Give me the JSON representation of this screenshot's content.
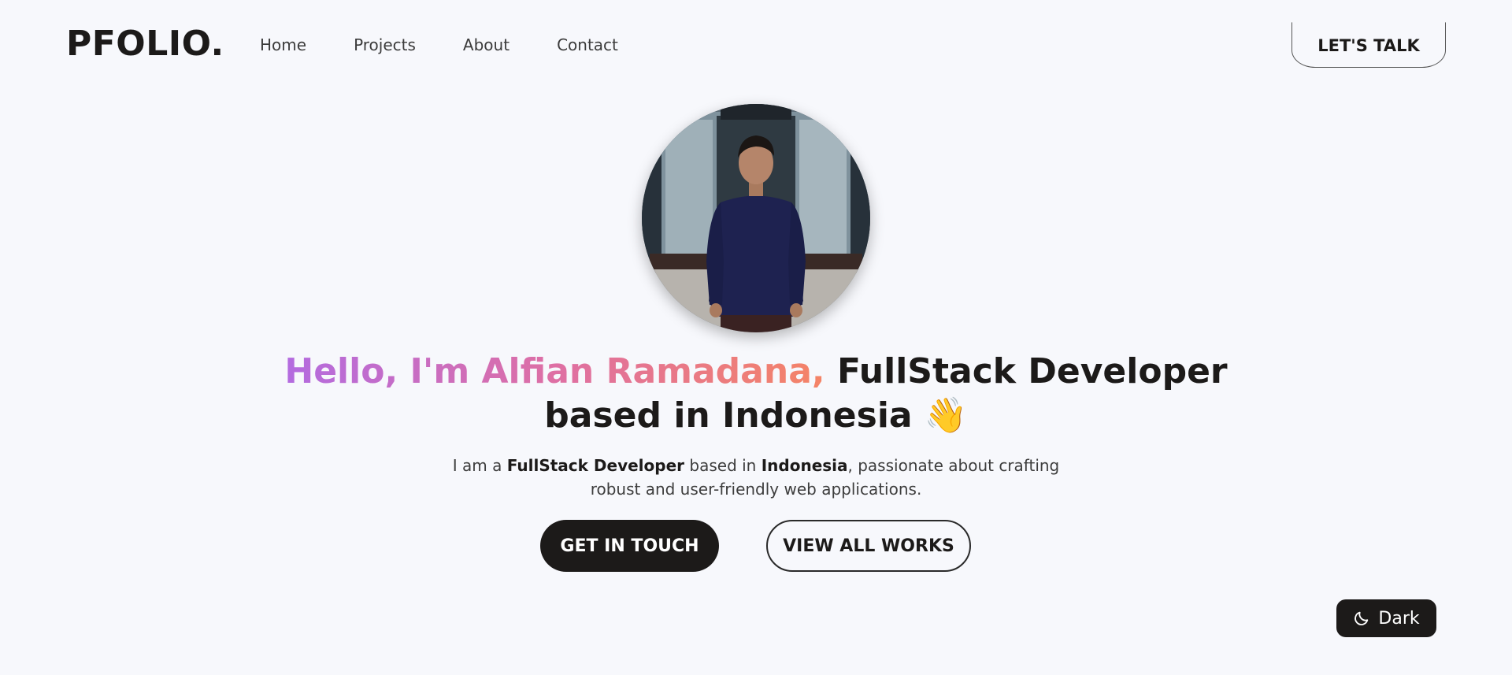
{
  "nav": {
    "logo": "PFOLIO.",
    "links": [
      {
        "label": "Home"
      },
      {
        "label": "Projects"
      },
      {
        "label": "About"
      },
      {
        "label": "Contact"
      }
    ],
    "cta_label": "LET'S TALK"
  },
  "hero": {
    "avatar_icon": "profile-photo",
    "headline_gradient": "Hello, I'm Alfian Ramadana,",
    "headline_rest": "FullStack Developer based in Indonesia",
    "headline_emoji": "👋",
    "description": {
      "part1": "I am a ",
      "bold1": "FullStack Developer",
      "part2": " based in ",
      "bold2": "Indonesia",
      "part3": ", passionate about crafting robust and user-friendly web applications."
    },
    "primary_button": "GET IN TOUCH",
    "secondary_button": "VIEW ALL WORKS"
  },
  "theme_toggle": {
    "label": "Dark",
    "icon": "moon-icon"
  },
  "colors": {
    "background": "#f7f8fc",
    "text": "#1c1a19",
    "gradient_start": "#b36be0",
    "gradient_mid": "#de6fa4",
    "gradient_end": "#f58466"
  }
}
